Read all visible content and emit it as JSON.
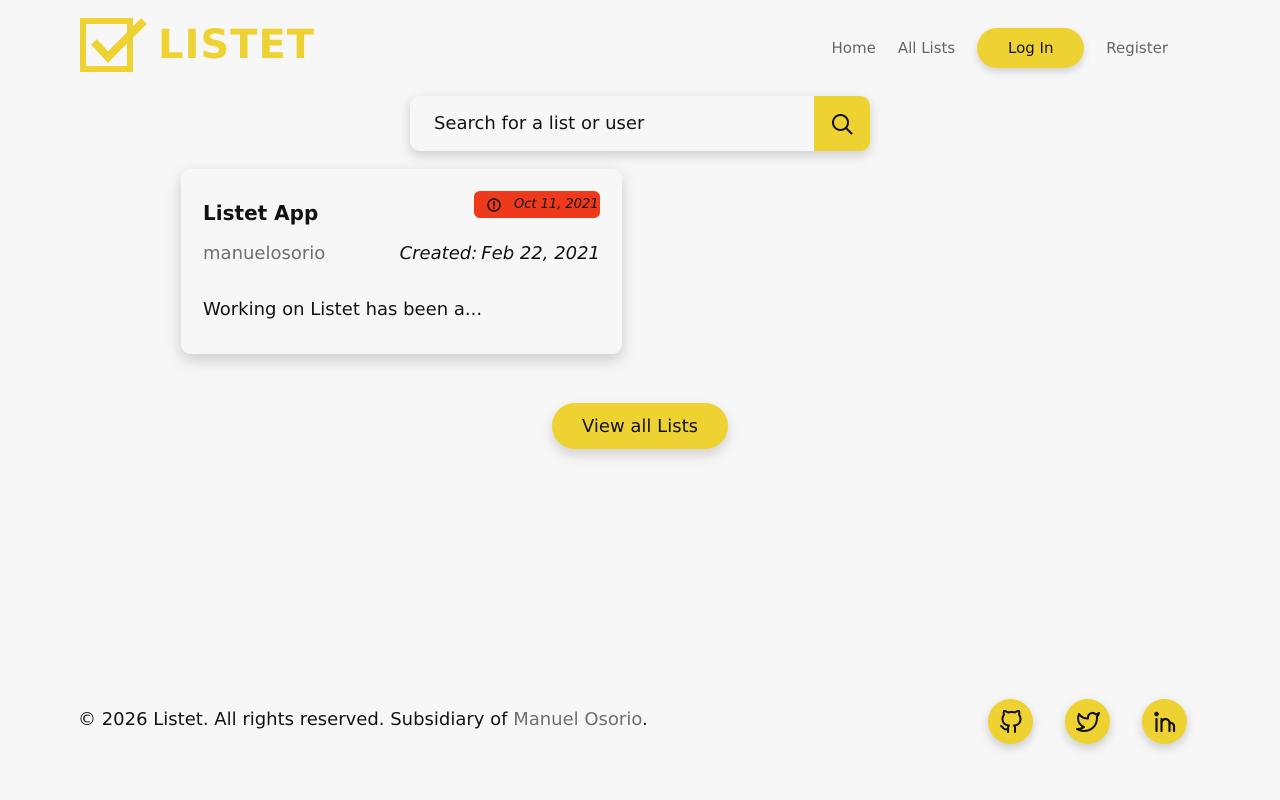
{
  "brand": {
    "name": "LISTET",
    "color": "#eed232"
  },
  "nav": {
    "home": "Home",
    "all_lists": "All Lists",
    "login": "Log In",
    "register": "Register"
  },
  "search": {
    "placeholder": "Search for a list or user",
    "button_icon": "search-icon"
  },
  "lists": [
    {
      "title": "Listet App",
      "due_date": "Oct 11, 2021",
      "due_icon": "alert-circle-icon",
      "author": "manuelosorio",
      "created_label": "Created:",
      "created_date": "Feb 22, 2021",
      "description": "Working on Listet has been a..."
    }
  ],
  "view_all_label": "View all Lists",
  "footer": {
    "copyright": "© 2026 Listet. All rights reserved. Subsidiary of ",
    "owner_link": "Manuel Osorio",
    "period": ".",
    "social": [
      {
        "name": "github-icon"
      },
      {
        "name": "twitter-icon"
      },
      {
        "name": "linkedin-icon"
      }
    ]
  },
  "colors": {
    "accent": "#eed232",
    "due_badge": "#ee3a1a",
    "background": "#f7f7f7",
    "muted_text": "#6f6f6f"
  }
}
